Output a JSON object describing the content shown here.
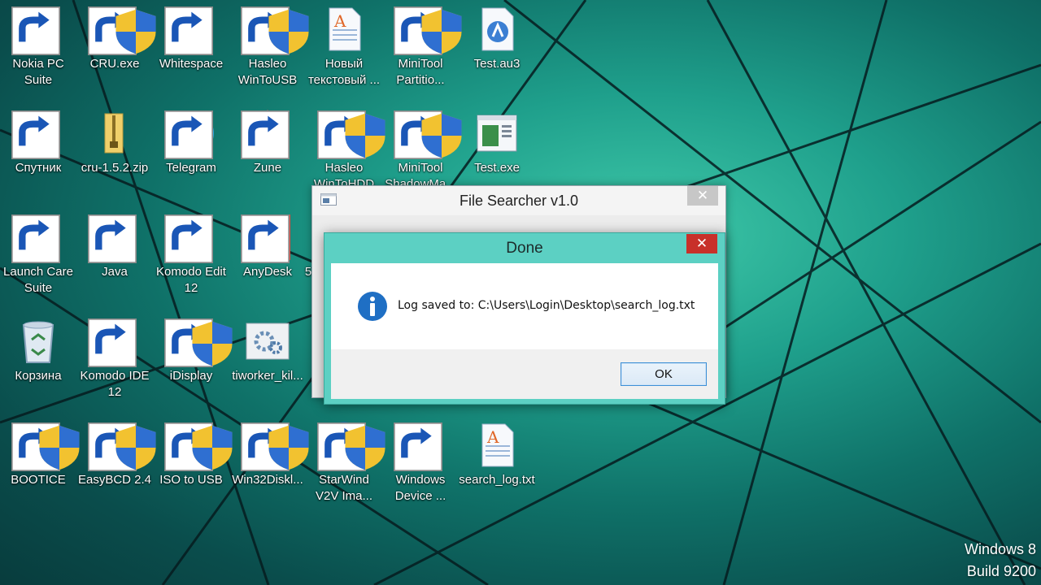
{
  "desktop": {
    "icons": [
      {
        "label": "Nokia PC Suite",
        "icon": "nokia-pc-suite-icon"
      },
      {
        "label": "CRU.exe",
        "icon": "monitor-icon"
      },
      {
        "label": "Whitespace",
        "icon": "code-brackets-icon"
      },
      {
        "label": "Hasleo WinToUSB",
        "icon": "windows-usb-icon"
      },
      {
        "label": "Новый текстовый ...",
        "icon": "text-document-icon"
      },
      {
        "label": "MiniTool Partitio...",
        "icon": "partition-wizard-icon"
      },
      {
        "label": "Test.au3",
        "icon": "autoit-script-icon"
      },
      {
        "label": "Спутник",
        "icon": "flutter-icon"
      },
      {
        "label": "cru-1.5.2.zip",
        "icon": "zip-folder-icon"
      },
      {
        "label": "Telegram",
        "icon": "telegram-icon"
      },
      {
        "label": "Zune",
        "icon": "zune-icon"
      },
      {
        "label": "Hasleo WinToHDD",
        "icon": "windows-hdd-icon"
      },
      {
        "label": "MiniTool ShadowMa...",
        "icon": "shadowmaker-icon"
      },
      {
        "label": "Test.exe",
        "icon": "application-window-icon"
      },
      {
        "label": "Launch Care Suite",
        "icon": "care-suite-icon"
      },
      {
        "label": "Java",
        "icon": "atom-icon"
      },
      {
        "label": "Komodo Edit 12",
        "icon": "komodo-edit-icon"
      },
      {
        "label": "AnyDesk",
        "icon": "anydesk-icon"
      },
      {
        "label": "5",
        "icon": "hidden-app-icon"
      },
      {
        "label": "Корзина",
        "icon": "recycle-bin-icon"
      },
      {
        "label": "Komodo IDE 12",
        "icon": "komodo-ide-icon"
      },
      {
        "label": "iDisplay",
        "icon": "idisplay-icon"
      },
      {
        "label": "tiworker_kil...",
        "icon": "settings-gears-icon"
      },
      {
        "label": "BOOTICE",
        "icon": "bootice-icon"
      },
      {
        "label": "EasyBCD 2.4",
        "icon": "easybcd-icon"
      },
      {
        "label": "ISO to USB",
        "icon": "usb-drive-icon"
      },
      {
        "label": "Win32Diskl...",
        "icon": "disk-imager-icon"
      },
      {
        "label": "StarWind V2V Ima...",
        "icon": "starwind-icon"
      },
      {
        "label": "Windows Device ...",
        "icon": "device-portal-icon"
      },
      {
        "label": "search_log.txt",
        "icon": "text-document-icon"
      }
    ]
  },
  "main_window": {
    "title": "File Searcher v1.0",
    "close_label": "✕"
  },
  "dialog": {
    "title": "Done",
    "close_label": "✕",
    "message": "Log saved to: C:\\Users\\Login\\Desktop\\search_log.txt",
    "ok_label": "OK"
  },
  "watermark": {
    "line1": "Windows 8",
    "line2": "Build 9200"
  },
  "colors": {
    "accent": "#5cd0c3",
    "close_red": "#c8302a",
    "info_blue": "#1f6fc4"
  }
}
